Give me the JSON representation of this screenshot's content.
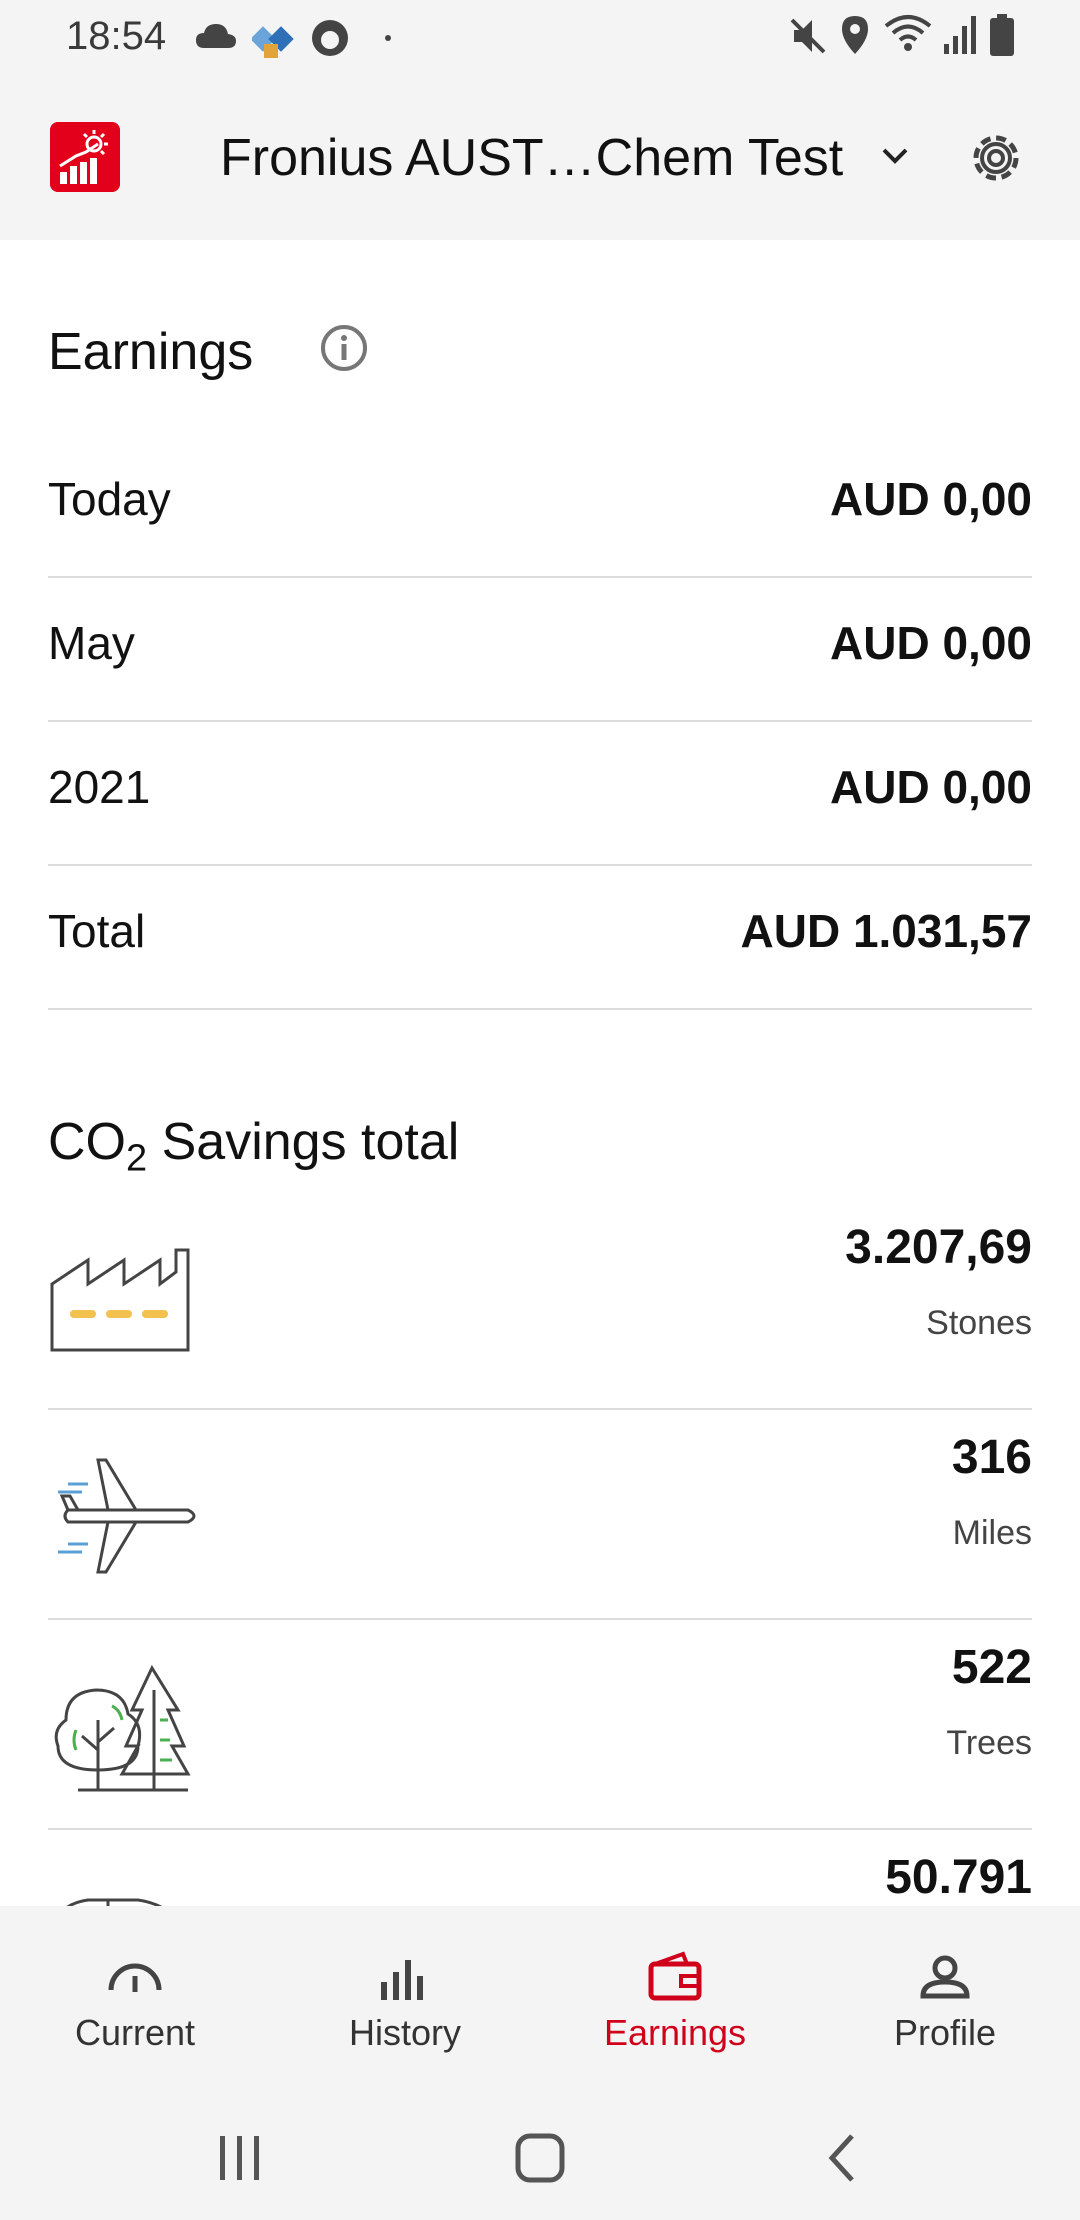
{
  "status_bar": {
    "time": "18:54"
  },
  "app_bar": {
    "station_name": "Fronius AUST…Chem Test",
    "brand_color": "#e2001a"
  },
  "earnings": {
    "title": "Earnings",
    "rows": [
      {
        "label": "Today",
        "value": "AUD 0,00"
      },
      {
        "label": "May",
        "value": "AUD 0,00"
      },
      {
        "label": "2021",
        "value": "AUD 0,00"
      },
      {
        "label": "Total",
        "value": "AUD 1.031,57"
      }
    ]
  },
  "co2": {
    "title_prefix": "CO",
    "title_sub": "2",
    "title_suffix": " Savings total",
    "rows": [
      {
        "icon": "factory-icon",
        "value": "3.207,69",
        "unit": "Stones"
      },
      {
        "icon": "airplane-icon",
        "value": "316",
        "unit": "Miles"
      },
      {
        "icon": "trees-icon",
        "value": "522",
        "unit": "Trees"
      },
      {
        "icon": "car-icon",
        "value": "50.791",
        "unit": ""
      }
    ]
  },
  "bottom_nav": {
    "items": [
      {
        "label": "Current",
        "icon": "gauge-icon"
      },
      {
        "label": "History",
        "icon": "bar-chart-icon"
      },
      {
        "label": "Earnings",
        "icon": "wallet-icon"
      },
      {
        "label": "Profile",
        "icon": "person-icon"
      }
    ],
    "active_index": 2,
    "active_color": "#d0021b"
  }
}
